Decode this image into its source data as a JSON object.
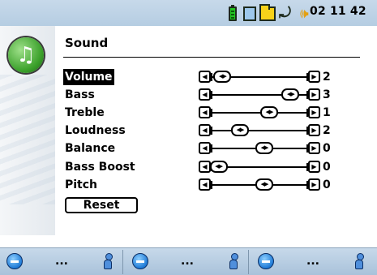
{
  "status": {
    "time": "02  11 42",
    "icons": [
      "battery-icon",
      "disk-icon",
      "folder-icon",
      "repeat-icon",
      "speaker-icon"
    ]
  },
  "app": {
    "icon": "music-note-icon"
  },
  "title": "Sound",
  "settings": [
    {
      "label": "Volume",
      "value": "2",
      "level": 0.12,
      "selected": true
    },
    {
      "label": "Bass",
      "value": "3",
      "level": 0.82
    },
    {
      "label": "Treble",
      "value": "1",
      "level": 0.6
    },
    {
      "label": "Loudness",
      "value": "2",
      "level": 0.3
    },
    {
      "label": "Balance",
      "value": "0",
      "level": 0.55
    },
    {
      "label": "Bass Boost",
      "value": "0",
      "level": 0.08
    },
    {
      "label": "Pitch",
      "value": "0",
      "level": 0.55
    }
  ],
  "reset_label": "Reset",
  "softkeys": [
    {
      "label": "...",
      "left_icon": "blue-button-icon",
      "right_icon": "person-icon"
    },
    {
      "label": "...",
      "left_icon": "blue-button-icon",
      "right_icon": "person-icon"
    },
    {
      "label": "...",
      "left_icon": "blue-button-icon",
      "right_icon": "person-icon"
    }
  ],
  "glyphs": {
    "left_arrow": "◀",
    "right_arrow": "▶",
    "knob": "◀▶"
  }
}
